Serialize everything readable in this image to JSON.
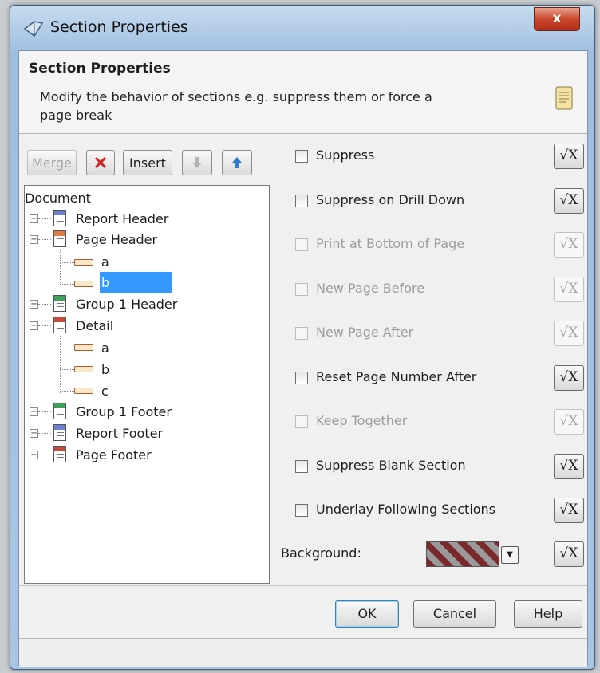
{
  "window": {
    "title": "Section Properties",
    "close_label": "x"
  },
  "header": {
    "title": "Section Properties",
    "description": "Modify the behavior of sections e.g. suppress them or force a page break"
  },
  "toolbar": {
    "merge_label": "Merge",
    "insert_label": "Insert"
  },
  "tree": {
    "root": "Document",
    "items": [
      {
        "label": "Report Header"
      },
      {
        "label": "Page Header"
      },
      {
        "label": "a"
      },
      {
        "label": "b"
      },
      {
        "label": "Group 1 Header"
      },
      {
        "label": "Detail"
      },
      {
        "label": "a"
      },
      {
        "label": "b"
      },
      {
        "label": "c"
      },
      {
        "label": "Group 1 Footer"
      },
      {
        "label": "Report Footer"
      },
      {
        "label": "Page Footer"
      }
    ]
  },
  "properties": [
    {
      "label": "Suppress",
      "enabled": true,
      "checked": false
    },
    {
      "label": "Suppress on Drill Down",
      "enabled": true,
      "checked": false
    },
    {
      "label": "Print at Bottom of Page",
      "enabled": false,
      "checked": false
    },
    {
      "label": "New Page Before",
      "enabled": false,
      "checked": false
    },
    {
      "label": "New Page After",
      "enabled": false,
      "checked": false
    },
    {
      "label": "Reset Page Number After",
      "enabled": true,
      "checked": false
    },
    {
      "label": "Keep Together",
      "enabled": false,
      "checked": false
    },
    {
      "label": "Suppress Blank Section",
      "enabled": true,
      "checked": false
    },
    {
      "label": "Underlay Following Sections",
      "enabled": true,
      "checked": false
    }
  ],
  "formula_button_label": "√X",
  "background": {
    "label": "Background:"
  },
  "footer": {
    "ok_label": "OK",
    "cancel_label": "Cancel",
    "help_label": "Help"
  },
  "colors": {
    "selection": "#3399ff",
    "close_button": "#c9452a",
    "disabled_text": "#9c9c9c"
  },
  "icons": {
    "title": "section-properties-icon",
    "header": "document-icon",
    "delete": "red-x-icon",
    "move_down": "arrow-down-icon",
    "move_up": "arrow-up-icon"
  }
}
